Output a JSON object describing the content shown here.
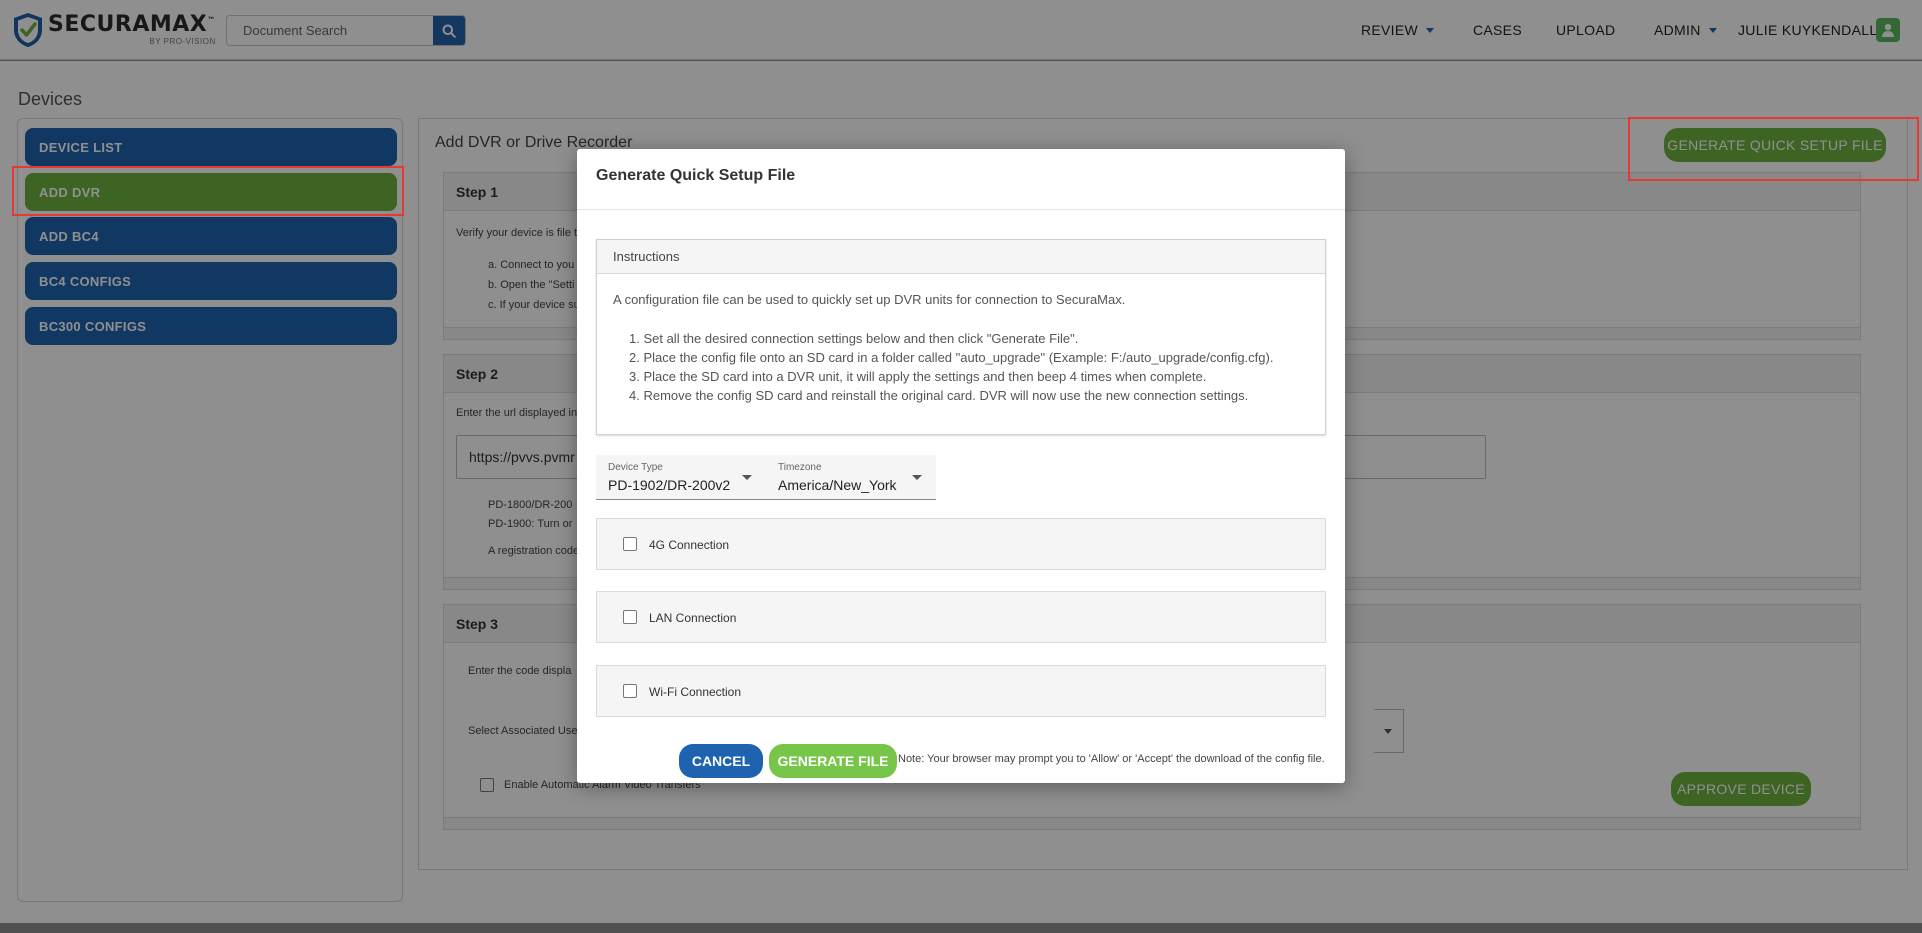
{
  "header": {
    "logo_name": "SECURAMAX",
    "logo_trademark": "™",
    "logo_sub": "BY PRO-VISION",
    "search_placeholder": "Document Search",
    "nav": {
      "review": "REVIEW",
      "cases": "CASES",
      "upload": "UPLOAD",
      "admin": "ADMIN",
      "user": "JULIE KUYKENDALL"
    },
    "accent_color": "#2563ad"
  },
  "page": {
    "title": "Devices"
  },
  "sidebar": {
    "items": [
      {
        "label": "DEVICE LIST",
        "active": false
      },
      {
        "label": "ADD DVR",
        "active": true
      },
      {
        "label": "ADD BC4",
        "active": false
      },
      {
        "label": "BC4 CONFIGS",
        "active": false
      },
      {
        "label": "BC300 CONFIGS",
        "active": false
      }
    ],
    "active_color": "#6db33f",
    "item_color": "#1f63b0"
  },
  "main": {
    "title": "Add DVR or Drive Recorder",
    "generate_quick_setup_label": "GENERATE QUICK SETUP FILE",
    "step1": {
      "title": "Step 1",
      "intro": "Verify your device is file t",
      "items": [
        "a. Connect to you",
        "b. Open the \"Setti",
        "c. If your device su"
      ]
    },
    "step2": {
      "title": "Step 2",
      "intro": "Enter the url displayed in",
      "url_value": "https://pvvs.pvmr",
      "notes": [
        "PD-1800/DR-200",
        "PD-1900: Turn or"
      ],
      "registration": "A registration code"
    },
    "step3": {
      "title": "Step 3",
      "code_text": "Enter the code displa",
      "select_user_text": "Select Associated Use",
      "alarm_label": "Enable Automatic Alarm Video Transfers",
      "approve_label": "APPROVE DEVICE"
    }
  },
  "modal": {
    "title": "Generate Quick Setup File",
    "instructions_header": "Instructions",
    "instructions_intro": "A configuration file can be used to quickly set up DVR units for connection to SecuraMax.",
    "instructions_steps": [
      "1. Set all the desired connection settings below and then click \"Generate File\".",
      "2. Place the config file onto an SD card in a folder called \"auto_upgrade\" (Example: F:/auto_upgrade/config.cfg).",
      "3. Place the SD card into a DVR unit, it will apply the settings and then beep 4 times when complete.",
      "4. Remove the config SD card and reinstall the original card. DVR will now use the new connection settings."
    ],
    "device_type": {
      "label": "Device Type",
      "value": "PD-1902/DR-200v2"
    },
    "timezone": {
      "label": "Timezone",
      "value": "America/New_York"
    },
    "connections": [
      {
        "label": "4G Connection",
        "checked": false
      },
      {
        "label": "LAN Connection",
        "checked": false
      },
      {
        "label": "Wi-Fi Connection",
        "checked": false
      }
    ],
    "cancel_label": "CANCEL",
    "generate_label": "GENERATE FILE",
    "note": "Note: Your browser may prompt you to 'Allow' or 'Accept' the download of the config file."
  }
}
